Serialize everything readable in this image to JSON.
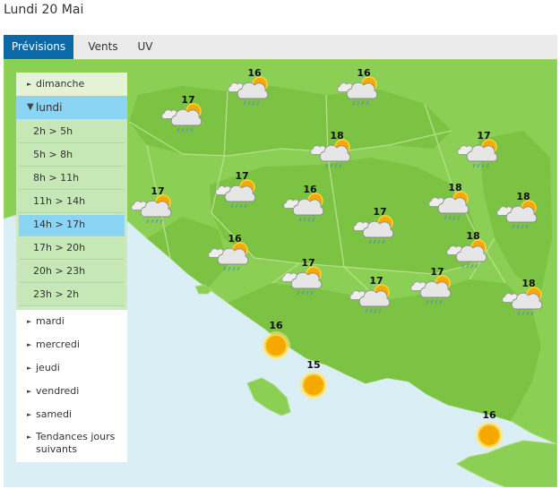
{
  "page": {
    "title": "Lundi 20 Mai"
  },
  "tabs": [
    {
      "label": "Prévisions",
      "active": true
    },
    {
      "label": "Vents",
      "active": false
    },
    {
      "label": "UV",
      "active": false
    }
  ],
  "sidebar": {
    "days": [
      {
        "label": "dimanche",
        "open": false
      },
      {
        "label": "lundi",
        "open": true
      },
      {
        "label": "mardi",
        "open": false
      },
      {
        "label": "mercredi",
        "open": false
      },
      {
        "label": "jeudi",
        "open": false
      },
      {
        "label": "vendredi",
        "open": false
      },
      {
        "label": "samedi",
        "open": false
      }
    ],
    "slots": [
      {
        "label": "2h > 5h",
        "selected": false
      },
      {
        "label": "5h > 8h",
        "selected": false
      },
      {
        "label": "8h > 11h",
        "selected": false
      },
      {
        "label": "11h > 14h",
        "selected": false
      },
      {
        "label": "14h > 17h",
        "selected": true
      },
      {
        "label": "17h > 20h",
        "selected": false
      },
      {
        "label": "20h > 23h",
        "selected": false
      },
      {
        "label": "23h > 2h",
        "selected": false
      }
    ],
    "trends_line1": "Tendances jours",
    "trends_line2": "suivants"
  },
  "map": {
    "colors": {
      "land": "#8ccf55",
      "sea": "#d9eef5",
      "region": "#7cc243",
      "border": "#b7e08e"
    },
    "forecasts": [
      {
        "temp": "16",
        "icon": "cloud-sun-rain-icon"
      },
      {
        "temp": "16",
        "icon": "cloud-sun-rain-icon"
      },
      {
        "temp": "17",
        "icon": "cloud-sun-rain-icon"
      },
      {
        "temp": "18",
        "icon": "cloud-sun-rain-icon"
      },
      {
        "temp": "17",
        "icon": "cloud-sun-rain-icon"
      },
      {
        "temp": "17",
        "icon": "cloud-sun-rain-icon"
      },
      {
        "temp": "16",
        "icon": "cloud-sun-rain-icon"
      },
      {
        "temp": "17",
        "icon": "cloud-sun-rain-icon"
      },
      {
        "temp": "18",
        "icon": "cloud-sun-rain-icon"
      },
      {
        "temp": "18",
        "icon": "cloud-sun-rain-icon"
      },
      {
        "temp": "17",
        "icon": "cloud-sun-rain-icon"
      },
      {
        "temp": "16",
        "icon": "cloud-sun-rain-icon"
      },
      {
        "temp": "18",
        "icon": "cloud-sun-rain-icon"
      },
      {
        "temp": "17",
        "icon": "cloud-sun-rain-icon"
      },
      {
        "temp": "17",
        "icon": "cloud-sun-rain-icon"
      },
      {
        "temp": "17",
        "icon": "cloud-sun-rain-icon"
      },
      {
        "temp": "18",
        "icon": "cloud-sun-rain-icon"
      },
      {
        "temp": "16",
        "icon": "sun-icon"
      },
      {
        "temp": "15",
        "icon": "sun-icon"
      },
      {
        "temp": "16",
        "icon": "sun-icon"
      }
    ]
  }
}
